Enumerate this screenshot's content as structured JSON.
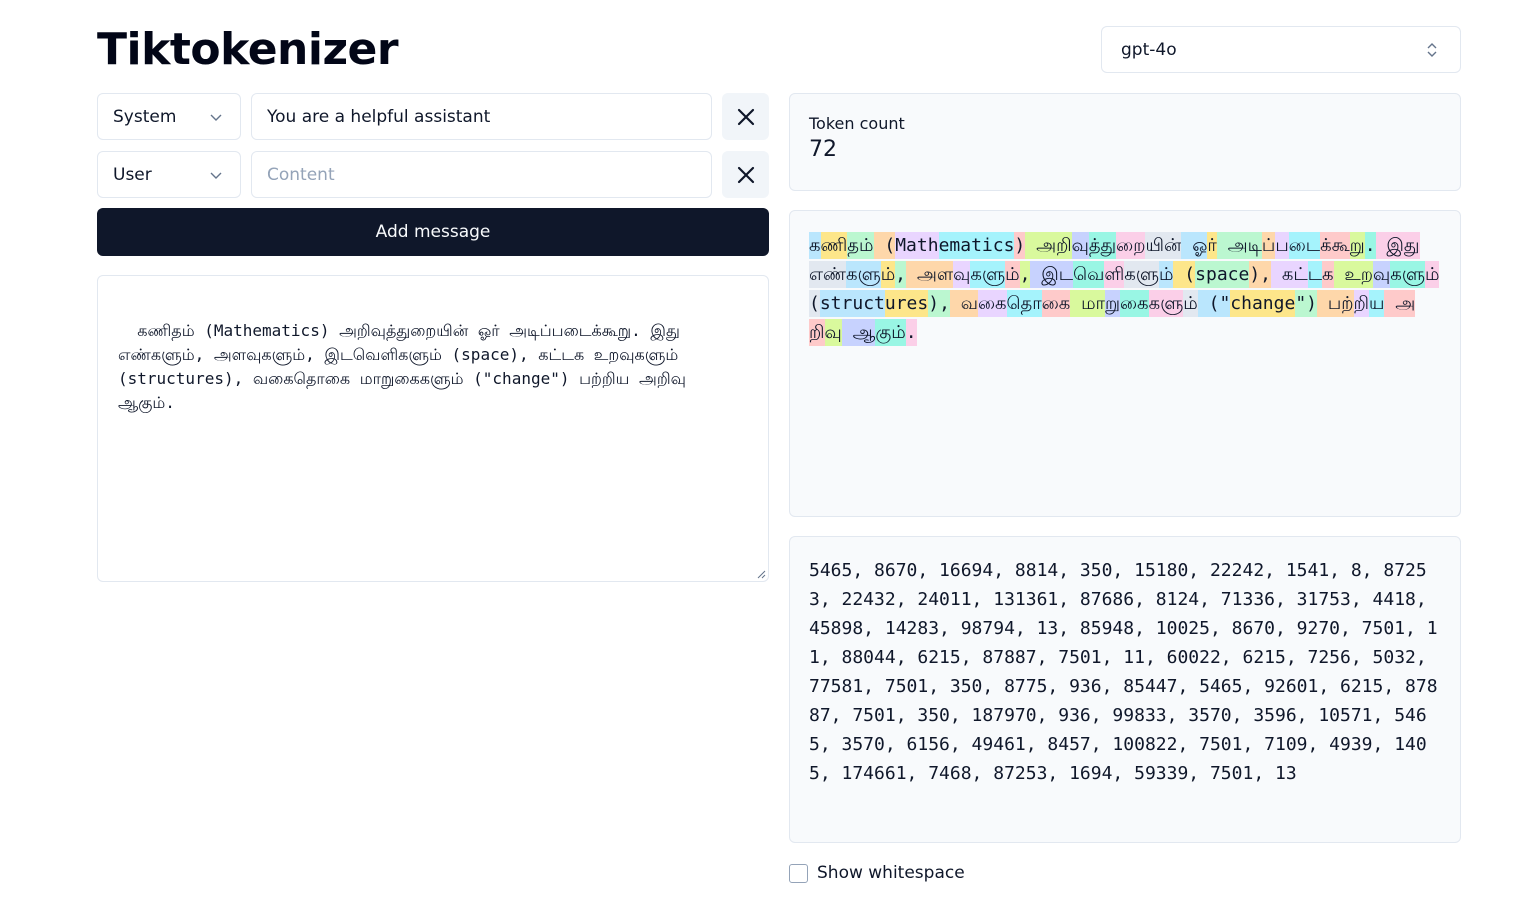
{
  "app": {
    "title": "Tiktokenizer"
  },
  "model": {
    "selected": "gpt-4o"
  },
  "messages": [
    {
      "role": "System",
      "content": "You are a helpful assistant",
      "placeholder": "Content"
    },
    {
      "role": "User",
      "content": "",
      "placeholder": "Content"
    }
  ],
  "add_message_label": "Add message",
  "input_text": "கணிதம் (Mathematics) அறிவுத்துறையின் ஓர் அடிப்படைக்கூறு. இது எண்களும், அளவுகளும், இடவெளிகளும் (space), கட்டக உறவுகளும் (structures), வகைதொகை மாறுகைகளும் (\"change\") பற்றிய அறிவு ஆகும்.",
  "token_count": {
    "label": "Token count",
    "value": "72"
  },
  "tokens": [
    "க",
    "ணி",
    "தம்",
    " (",
    "Math",
    "ematics",
    ")",
    " அற",
    "ிவு",
    "த்த",
    "ுற",
    "ையின்",
    " ஓ",
    "ர்",
    " அட",
    "ிப",
    "்ப",
    "டை",
    "க்க",
    "ூற",
    "ு",
    ".",
    " இது",
    " எண்",
    "கள",
    "ும்",
    ",",
    " அள",
    "வு",
    "கள",
    "ும்",
    ",",
    " இட",
    "வெ",
    "ளி",
    "கள",
    "ும்",
    " (",
    "space",
    "),",
    " கட",
    "்ட",
    "க",
    " உற",
    "வு",
    "கள",
    "ும்",
    " (",
    "struct",
    "ures",
    "),",
    " வ",
    "கை",
    "தொ",
    "கை",
    " மா",
    "று",
    "கை",
    "கள",
    "ும்",
    " (\"",
    "change",
    "\")",
    " பற",
    "்றி",
    "ய",
    " அற",
    "ிவு",
    " ஆ",
    "கும்",
    "."
  ],
  "token_colors": [
    "#bae6fd",
    "#fde68a",
    "#bbf7d0",
    "#fed7aa",
    "#e9d5ff",
    "#a5f3fc",
    "#fecaca",
    "#d9f99d",
    "#c7d2fe",
    "#99f6e4",
    "#fbcfe8",
    "#e2e8f0"
  ],
  "token_ids": "5465, 8670, 16694, 8814, 350, 15180, 22242, 1541, 8, 87253, 22432, 24011, 131361, 87686, 8124, 71336, 31753, 4418, 45898, 14283, 98794, 13, 85948, 10025, 8670, 9270, 7501, 11, 88044, 6215, 87887, 7501, 11, 60022, 6215, 7256, 5032, 77581, 7501, 350, 8775, 936, 85447, 5465, 92601, 6215, 87887, 7501, 350, 187970, 936, 99833, 3570, 3596, 10571, 5465, 3570, 6156, 49461, 8457, 100822, 7501, 7109, 4939, 1405, 174661, 7468, 87253, 1694, 59339, 7501, 13",
  "show_whitespace": {
    "label": "Show whitespace",
    "checked": false
  }
}
